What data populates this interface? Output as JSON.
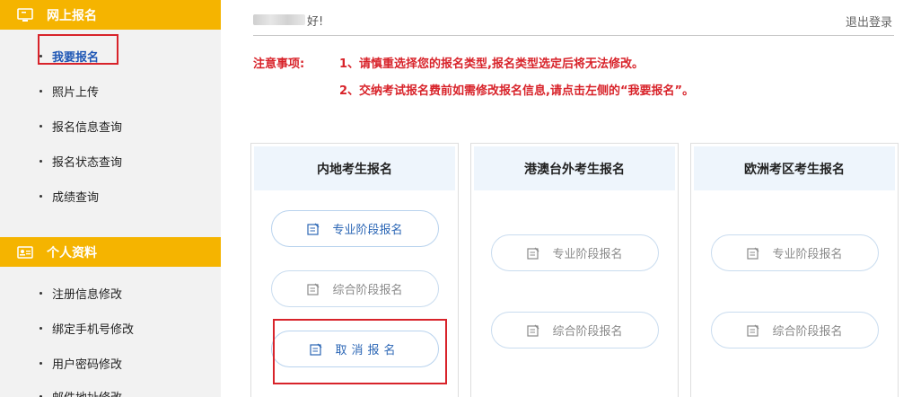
{
  "sidebar": {
    "section1": {
      "title": "网上报名",
      "icon": "monitor-icon"
    },
    "section1_items": [
      {
        "label": "我要报名",
        "active": true
      },
      {
        "label": "照片上传"
      },
      {
        "label": "报名信息查询"
      },
      {
        "label": "报名状态查询"
      },
      {
        "label": "成绩查询"
      }
    ],
    "section2": {
      "title": "个人资料",
      "icon": "id-card-icon"
    },
    "section2_items": [
      {
        "label": "注册信息修改"
      },
      {
        "label": "绑定手机号修改"
      },
      {
        "label": "用户密码修改"
      },
      {
        "label": "邮件地址修改"
      }
    ]
  },
  "header": {
    "greeting_suffix": "好!",
    "logout_label": "退出登录"
  },
  "notice": {
    "label": "注意事项:",
    "line1": "1、请慎重选择您的报名类型,报名类型选定后将无法修改。",
    "line2": "2、交纳考试报名费前如需修改报名信息,请点击左侧的“我要报名”。"
  },
  "cards": [
    {
      "title": "内地考生报名",
      "buttons": [
        "专业阶段报名",
        "综合阶段报名",
        "取消报名"
      ]
    },
    {
      "title": "港澳台外考生报名",
      "buttons": [
        "专业阶段报名",
        "综合阶段报名"
      ]
    },
    {
      "title": "欧洲考区考生报名",
      "buttons": [
        "专业阶段报名",
        "综合阶段报名"
      ]
    }
  ],
  "colors": {
    "accent": "#f5b400",
    "notice_red": "#d8232a",
    "link_blue": "#2b66b5",
    "card_head_bg": "#eef5fc"
  }
}
